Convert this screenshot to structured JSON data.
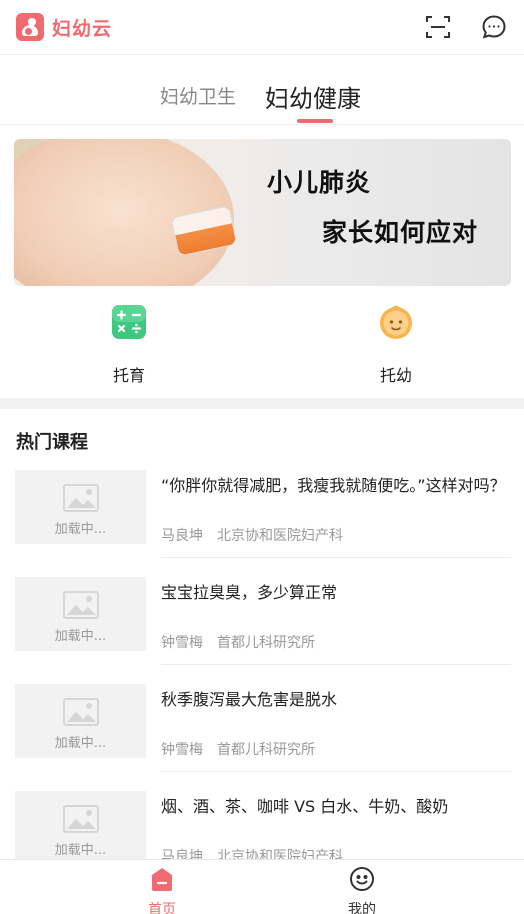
{
  "app": {
    "title": "妇幼云",
    "accent_color": "#f06b6f"
  },
  "header": {
    "scan_icon": "scan-icon",
    "message_icon": "message-icon"
  },
  "tabs": [
    {
      "label": "妇幼卫生",
      "active": false
    },
    {
      "label": "妇幼健康",
      "active": true
    }
  ],
  "banner": {
    "line1": "小儿肺炎",
    "line2": "家长如何应对"
  },
  "quick_links": [
    {
      "label": "托育",
      "icon": "calculator-icon"
    },
    {
      "label": "托幼",
      "icon": "baby-face-icon"
    }
  ],
  "courses_section": {
    "title": "热门课程",
    "loading_text": "加载中...",
    "items": [
      {
        "title": "“你胖你就得减肥，我瘦我就随便吃。”这样对吗？",
        "author": "马良坤",
        "org": "北京协和医院妇产科"
      },
      {
        "title": "宝宝拉臭臭，多少算正常",
        "author": "钟雪梅",
        "org": "首都儿科研究所"
      },
      {
        "title": "秋季腹泻最大危害是脱水",
        "author": "钟雪梅",
        "org": "首都儿科研究所"
      },
      {
        "title": "烟、酒、茶、咖啡 VS 白水、牛奶、酸奶",
        "author": "马良坤",
        "org": "北京协和医院妇产科"
      }
    ]
  },
  "bottom_nav": [
    {
      "label": "首页",
      "icon": "home-icon",
      "active": true
    },
    {
      "label": "我的",
      "icon": "profile-icon",
      "active": false
    }
  ]
}
